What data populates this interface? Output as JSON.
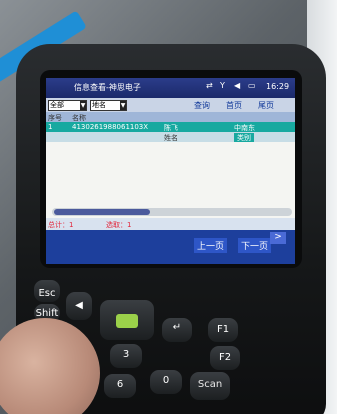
{
  "screen": {
    "title": "信息查看-神思电子",
    "time": "16:29",
    "filter_value": "全部",
    "filter2_value": "地名",
    "menu": [
      "查询",
      "首页",
      "尾页"
    ],
    "col_headers": [
      "序号",
      "名称"
    ],
    "record": {
      "index": "1",
      "id": "4130261988061103X",
      "name": "陈飞",
      "place": "中南东"
    },
    "sub_headers": [
      "姓名",
      "类别"
    ],
    "footer_title": "总计：1",
    "footer_sel": "选取：1",
    "page_buttons": [
      "上一页",
      "下一页"
    ],
    "go_label": ">"
  },
  "keys": {
    "esc": "Esc",
    "shift": "Shift",
    "f1": "F1",
    "f2": "F2",
    "scan": "Scan",
    "k3": "3",
    "k6": "6",
    "k0": "0"
  }
}
